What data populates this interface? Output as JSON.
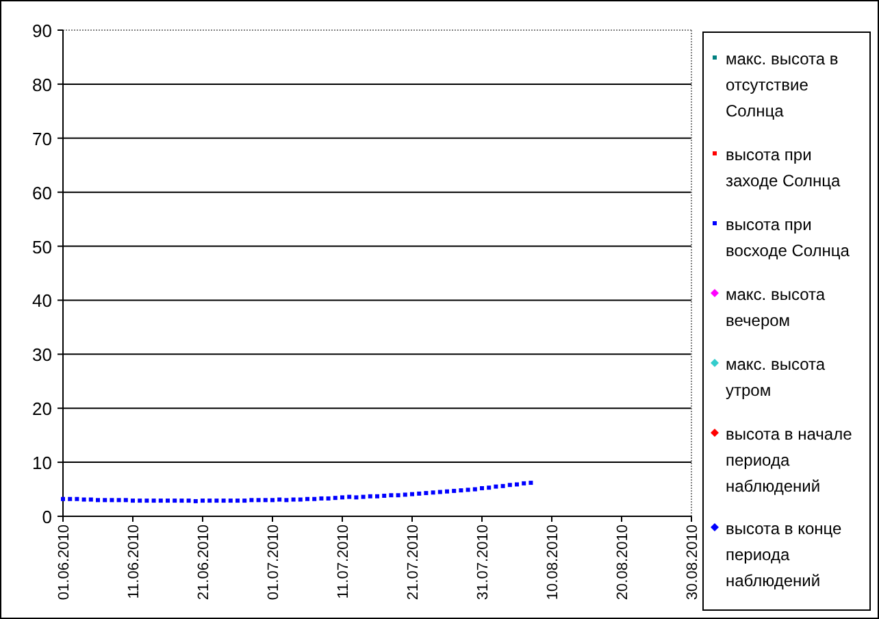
{
  "chart_data": {
    "type": "scatter",
    "grid": true,
    "ylim": [
      0,
      90
    ],
    "yticks": [
      0,
      10,
      20,
      30,
      40,
      50,
      60,
      70,
      80,
      90
    ],
    "categories": [
      "01.06.2010",
      null,
      null,
      null,
      null,
      null,
      null,
      null,
      null,
      null,
      "11.06.2010",
      null,
      null,
      null,
      null,
      null,
      null,
      null,
      null,
      null,
      "21.06.2010",
      null,
      null,
      null,
      null,
      null,
      null,
      null,
      null,
      null,
      "01.07.2010",
      null,
      null,
      null,
      null,
      null,
      null,
      null,
      null,
      null,
      "11.07.2010",
      null,
      null,
      null,
      null,
      null,
      null,
      null,
      null,
      null,
      "21.07.2010",
      null,
      null,
      null,
      null,
      null,
      null,
      null,
      null,
      null,
      "31.07.2010",
      null,
      null,
      null,
      null,
      null,
      null,
      null,
      null,
      null,
      "10.08.2010",
      null,
      null,
      null,
      null,
      null,
      null,
      null,
      null,
      null,
      "20.08.2010",
      null,
      null,
      null,
      null,
      null,
      null,
      null,
      null,
      null,
      "30.08.2010"
    ],
    "series": [
      {
        "name": "макс. высота в отсутствие Солнца",
        "color": "#008080",
        "marker": "square",
        "values": [
          null,
          null,
          null,
          null,
          null,
          null,
          null,
          null,
          null,
          null,
          null,
          null,
          null,
          null,
          null,
          null,
          null,
          null,
          null,
          null,
          null,
          null,
          null,
          null,
          null,
          null,
          null,
          null,
          null,
          null,
          null,
          null,
          null,
          null,
          null,
          null,
          null,
          null,
          null,
          null,
          null,
          null,
          null,
          null,
          null,
          null,
          null,
          null,
          null,
          null,
          null,
          null,
          null,
          null,
          null,
          null,
          null,
          null,
          null,
          null,
          null,
          null,
          null,
          null,
          null,
          null,
          null,
          null,
          null,
          null,
          null,
          null,
          null,
          null,
          null,
          null,
          null,
          null,
          null,
          null,
          null,
          null,
          null,
          null,
          null,
          null,
          null,
          null,
          null,
          null,
          null
        ]
      },
      {
        "name": "высота при заходе Солнца",
        "color": "#ff0000",
        "marker": "square",
        "values": [
          null,
          null,
          null,
          null,
          null,
          null,
          null,
          null,
          null,
          null,
          null,
          null,
          null,
          null,
          null,
          null,
          null,
          null,
          null,
          null,
          null,
          null,
          null,
          null,
          null,
          null,
          null,
          null,
          null,
          null,
          null,
          null,
          null,
          null,
          null,
          null,
          null,
          null,
          null,
          null,
          null,
          null,
          null,
          null,
          null,
          null,
          null,
          null,
          null,
          null,
          null,
          null,
          null,
          null,
          null,
          null,
          null,
          null,
          null,
          null,
          null,
          null,
          null,
          null,
          null,
          null,
          null,
          null,
          null,
          null,
          null,
          null,
          null,
          null,
          null,
          null,
          null,
          null,
          null,
          null,
          null,
          null,
          null,
          null,
          null,
          null,
          null,
          null,
          null,
          null,
          null
        ]
      },
      {
        "name": "высота при восходе Солнца",
        "color": "#0000ff",
        "marker": "square",
        "values": [
          3.2,
          3.2,
          3.2,
          3.1,
          3.1,
          3.0,
          3.0,
          3.0,
          3.0,
          3.0,
          2.9,
          2.9,
          2.9,
          2.9,
          2.9,
          2.9,
          2.9,
          2.9,
          2.9,
          2.8,
          2.9,
          2.9,
          2.9,
          2.9,
          2.9,
          2.9,
          2.9,
          3.0,
          3.0,
          3.0,
          3.0,
          3.1,
          3.0,
          3.1,
          3.1,
          3.2,
          3.2,
          3.3,
          3.3,
          3.4,
          3.5,
          3.6,
          3.5,
          3.6,
          3.7,
          3.7,
          3.8,
          3.9,
          3.9,
          4.0,
          4.1,
          4.2,
          4.3,
          4.4,
          4.5,
          4.6,
          4.7,
          4.8,
          4.9,
          5.0,
          5.2,
          5.3,
          5.5,
          5.6,
          5.8,
          5.9,
          6.1,
          6.2,
          null,
          null,
          null,
          null,
          null,
          null,
          null,
          null,
          null,
          null,
          null,
          null,
          null,
          null,
          null,
          null,
          null,
          null,
          null,
          null,
          null,
          null,
          null
        ]
      },
      {
        "name": "макс. высота вечером",
        "color": "#ff00ff",
        "marker": "diamond",
        "values": [
          null,
          null,
          null,
          null,
          null,
          null,
          null,
          null,
          null,
          null,
          null,
          null,
          null,
          null,
          null,
          null,
          null,
          null,
          null,
          null,
          null,
          null,
          null,
          null,
          null,
          null,
          null,
          null,
          null,
          null,
          null,
          null,
          null,
          null,
          null,
          null,
          null,
          null,
          null,
          null,
          null,
          null,
          null,
          null,
          null,
          null,
          null,
          null,
          null,
          null,
          null,
          null,
          null,
          null,
          null,
          null,
          null,
          null,
          null,
          null,
          null,
          null,
          null,
          null,
          null,
          null,
          null,
          null,
          null,
          null,
          null,
          null,
          null,
          null,
          null,
          null,
          null,
          null,
          null,
          null,
          null,
          null,
          null,
          null,
          null,
          null,
          null,
          null,
          null,
          null,
          null
        ]
      },
      {
        "name": "макс. высота утром",
        "color": "#33cccc",
        "marker": "diamond",
        "values": [
          null,
          null,
          null,
          null,
          null,
          null,
          null,
          null,
          null,
          null,
          null,
          null,
          null,
          null,
          null,
          null,
          null,
          null,
          null,
          null,
          null,
          null,
          null,
          null,
          null,
          null,
          null,
          null,
          null,
          null,
          null,
          null,
          null,
          null,
          null,
          null,
          null,
          null,
          null,
          null,
          null,
          null,
          null,
          null,
          null,
          null,
          null,
          null,
          null,
          null,
          null,
          null,
          null,
          null,
          null,
          null,
          null,
          null,
          null,
          null,
          null,
          null,
          null,
          null,
          null,
          null,
          null,
          null,
          null,
          null,
          null,
          null,
          null,
          null,
          null,
          null,
          null,
          null,
          null,
          null,
          null,
          null,
          null,
          null,
          null,
          null,
          null,
          null,
          null,
          null,
          null
        ]
      },
      {
        "name": "высота в начале периода наблюдений",
        "color": "#ff0000",
        "marker": "diamond",
        "values": [
          null,
          null,
          null,
          null,
          null,
          null,
          null,
          null,
          null,
          null,
          null,
          null,
          null,
          null,
          null,
          null,
          null,
          null,
          null,
          null,
          null,
          null,
          null,
          null,
          null,
          null,
          null,
          null,
          null,
          null,
          null,
          null,
          null,
          null,
          null,
          null,
          null,
          null,
          null,
          null,
          null,
          null,
          null,
          null,
          null,
          null,
          null,
          null,
          null,
          null,
          null,
          null,
          null,
          null,
          null,
          null,
          null,
          null,
          null,
          null,
          null,
          null,
          null,
          null,
          null,
          null,
          null,
          null,
          null,
          null,
          null,
          null,
          null,
          null,
          null,
          null,
          null,
          null,
          null,
          null,
          null,
          null,
          null,
          null,
          null,
          null,
          null,
          null,
          null,
          null,
          null
        ]
      },
      {
        "name": "высота в конце периода наблюдений",
        "color": "#0000ff",
        "marker": "diamond",
        "values": [
          null,
          null,
          null,
          null,
          null,
          null,
          null,
          null,
          null,
          null,
          null,
          null,
          null,
          null,
          null,
          null,
          null,
          null,
          null,
          null,
          null,
          null,
          null,
          null,
          null,
          null,
          null,
          null,
          null,
          null,
          null,
          null,
          null,
          null,
          null,
          null,
          null,
          null,
          null,
          null,
          null,
          null,
          null,
          null,
          null,
          null,
          null,
          null,
          null,
          null,
          null,
          null,
          null,
          null,
          null,
          null,
          null,
          null,
          null,
          null,
          null,
          null,
          null,
          null,
          null,
          null,
          null,
          null,
          null,
          null,
          null,
          null,
          null,
          null,
          null,
          null,
          null,
          null,
          null,
          null,
          null,
          null,
          null,
          null,
          null,
          null,
          null,
          null,
          null,
          null,
          null
        ]
      }
    ]
  }
}
